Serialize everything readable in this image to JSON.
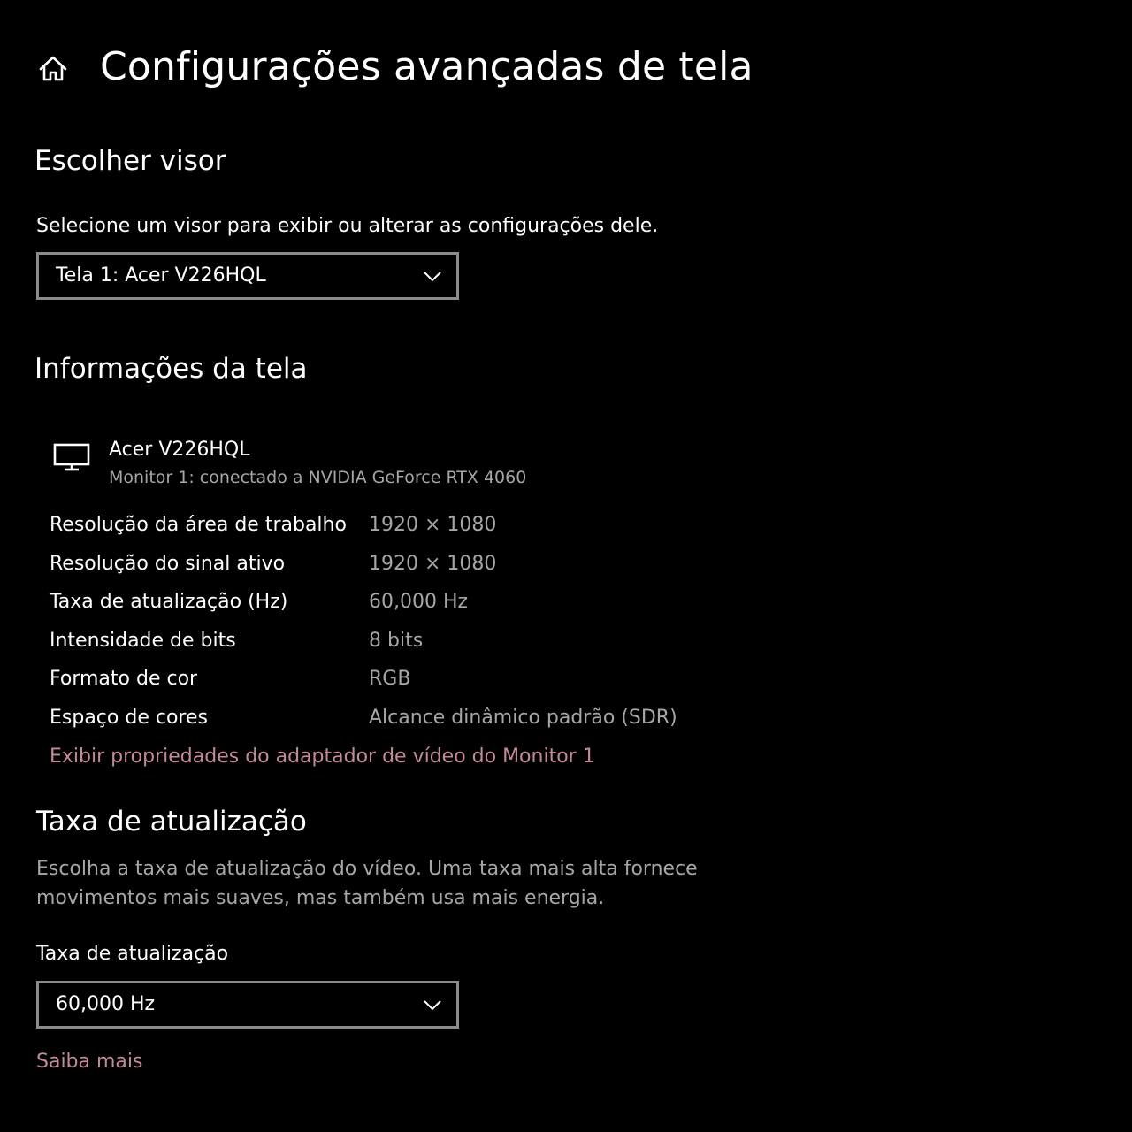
{
  "header": {
    "title": "Configurações avançadas de tela",
    "home_icon": "home-icon"
  },
  "choose_display": {
    "heading": "Escolher visor",
    "description": "Selecione um visor para exibir ou alterar as configurações dele.",
    "dropdown_value": "Tela 1: Acer V226HQL"
  },
  "display_info": {
    "heading": "Informações da tela",
    "monitor_icon": "monitor-icon",
    "monitor_name": "Acer V226HQL",
    "monitor_subtitle": "Monitor 1: conectado a NVIDIA GeForce RTX 4060",
    "rows": [
      {
        "label": "Resolução da área de trabalho",
        "value": "1920 × 1080"
      },
      {
        "label": "Resolução do sinal ativo",
        "value": "1920 × 1080"
      },
      {
        "label": "Taxa de atualização (Hz)",
        "value": "60,000 Hz"
      },
      {
        "label": "Intensidade de bits",
        "value": "8 bits"
      },
      {
        "label": "Formato de cor",
        "value": "RGB"
      },
      {
        "label": "Espaço de cores",
        "value": "Alcance dinâmico padrão (SDR)"
      }
    ],
    "adapter_link": "Exibir propriedades do adaptador de vídeo do Monitor 1"
  },
  "refresh_rate": {
    "heading": "Taxa de atualização",
    "description": "Escolha a taxa de atualização do vídeo. Uma taxa mais alta fornece movimentos mais suaves, mas também usa mais energia.",
    "field_label": "Taxa de atualização",
    "dropdown_value": "60,000 Hz",
    "learn_more": "Saiba mais"
  },
  "colors": {
    "background": "#000000",
    "text": "#ffffff",
    "muted_text": "#a6a6a6",
    "link": "#c58a98",
    "dropdown_border": "#8a8a8a"
  }
}
